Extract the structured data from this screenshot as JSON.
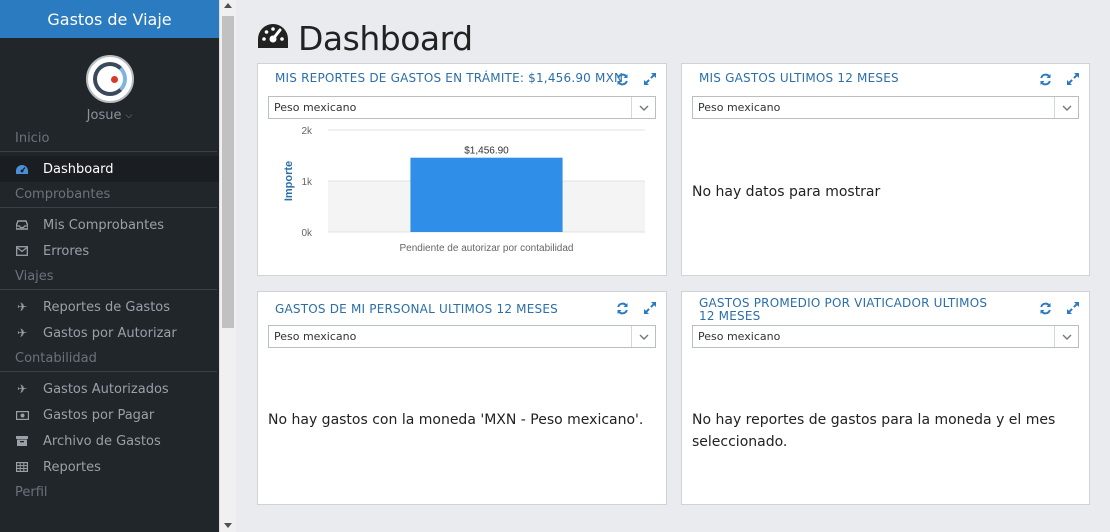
{
  "app": {
    "title": "Gastos de Viaje"
  },
  "user": {
    "name": "Josue"
  },
  "sidebar": {
    "sections": [
      {
        "label": "Inicio",
        "items": [
          {
            "label": "Dashboard",
            "icon": "dashboard-icon",
            "active": true
          }
        ]
      },
      {
        "label": "Comprobantes",
        "items": [
          {
            "label": "Mis Comprobantes",
            "icon": "inbox-icon"
          },
          {
            "label": "Errores",
            "icon": "envelope-icon"
          }
        ]
      },
      {
        "label": "Viajes",
        "items": [
          {
            "label": "Reportes de Gastos",
            "icon": "plane-icon"
          },
          {
            "label": "Gastos por Autorizar",
            "icon": "plane-icon"
          }
        ]
      },
      {
        "label": "Contabilidad",
        "items": [
          {
            "label": "Gastos Autorizados",
            "icon": "plane-icon"
          },
          {
            "label": "Gastos por Pagar",
            "icon": "money-icon"
          },
          {
            "label": "Archivo de Gastos",
            "icon": "archive-icon"
          },
          {
            "label": "Reportes",
            "icon": "table-icon"
          }
        ]
      },
      {
        "label": "Perfil",
        "items": []
      }
    ]
  },
  "page": {
    "title": "Dashboard"
  },
  "panels": [
    {
      "title": "MIS REPORTES DE GASTOS EN TRÁMITE: $1,456.90 MXN",
      "select": "Peso mexicano"
    },
    {
      "title": "MIS GASTOS ULTIMOS 12 MESES",
      "select": "Peso mexicano",
      "message": "No hay datos para mostrar"
    },
    {
      "title": "GASTOS DE MI PERSONAL ULTIMOS 12 MESES",
      "select": "Peso mexicano",
      "message": "No hay gastos con la moneda 'MXN - Peso mexicano'."
    },
    {
      "title": "GASTOS PROMEDIO POR VIATICADOR ULTIMOS 12 MESES",
      "select": "Peso mexicano",
      "message": "No hay reportes de gastos para la moneda y el mes seleccionado."
    }
  ],
  "colors": {
    "accent": "#2b7bc0",
    "bar": "#2f8fe8",
    "sidebar": "#21262b"
  },
  "chart_data": {
    "type": "bar",
    "categories": [
      "Pendiente de autorizar por contabilidad"
    ],
    "values": [
      1456.9
    ],
    "data_labels": [
      "$1,456.90"
    ],
    "ylabel": "Importe",
    "yticks": [
      "0k",
      "1k",
      "2k"
    ],
    "ylim": [
      0,
      2000
    ]
  }
}
